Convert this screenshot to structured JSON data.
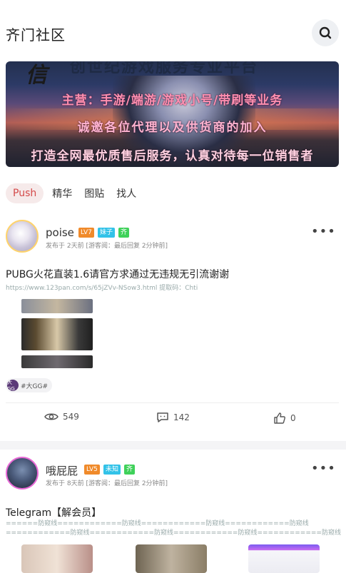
{
  "header": {
    "title": "齐门社区",
    "search_icon": "search-icon"
  },
  "banner": {
    "logo_char": "信",
    "line1": "创世纪游戏服务专业平台",
    "line2": "主营：手游/端游/游戏小号/带刷等业务",
    "line3": "诚邀各位代理以及供货商的加入",
    "line4": "打造全网最优质售后服务，认真对待每一位销售者"
  },
  "tabs": [
    {
      "label": "Push",
      "active": true
    },
    {
      "label": "精华",
      "active": false
    },
    {
      "label": "图贴",
      "active": false
    },
    {
      "label": "找人",
      "active": false
    }
  ],
  "posts": [
    {
      "username": "poise",
      "level": "LV7",
      "tag1": "妹子",
      "tag2": "齐",
      "meta": "发布于 2天前  [游客阅：最后回复 2分钟前]",
      "title": "PUBG火花直装1.6请官方求通过无违规无引流谢谢",
      "subtitle": "https://www.123pan.com/s/65jZVv-NSow3.html  提取码：Chti",
      "topic": "#大GG#",
      "topic_icon": "大GG",
      "views": "549",
      "comments": "142",
      "likes": "0"
    },
    {
      "username": "哦屁屁",
      "level": "LV5",
      "tag1": "未知",
      "tag2": "齐",
      "meta": "发布于 8天前  [游客阅：最后回复 2分钟前]",
      "title": "Telegram【解会员】",
      "subtitle": "======防窥线============防窥线============防窥线============防窥线============防窥线============防窥线============防窥线============防窥线============防窥线======↓↓↓有想学习定向..."
    }
  ]
}
